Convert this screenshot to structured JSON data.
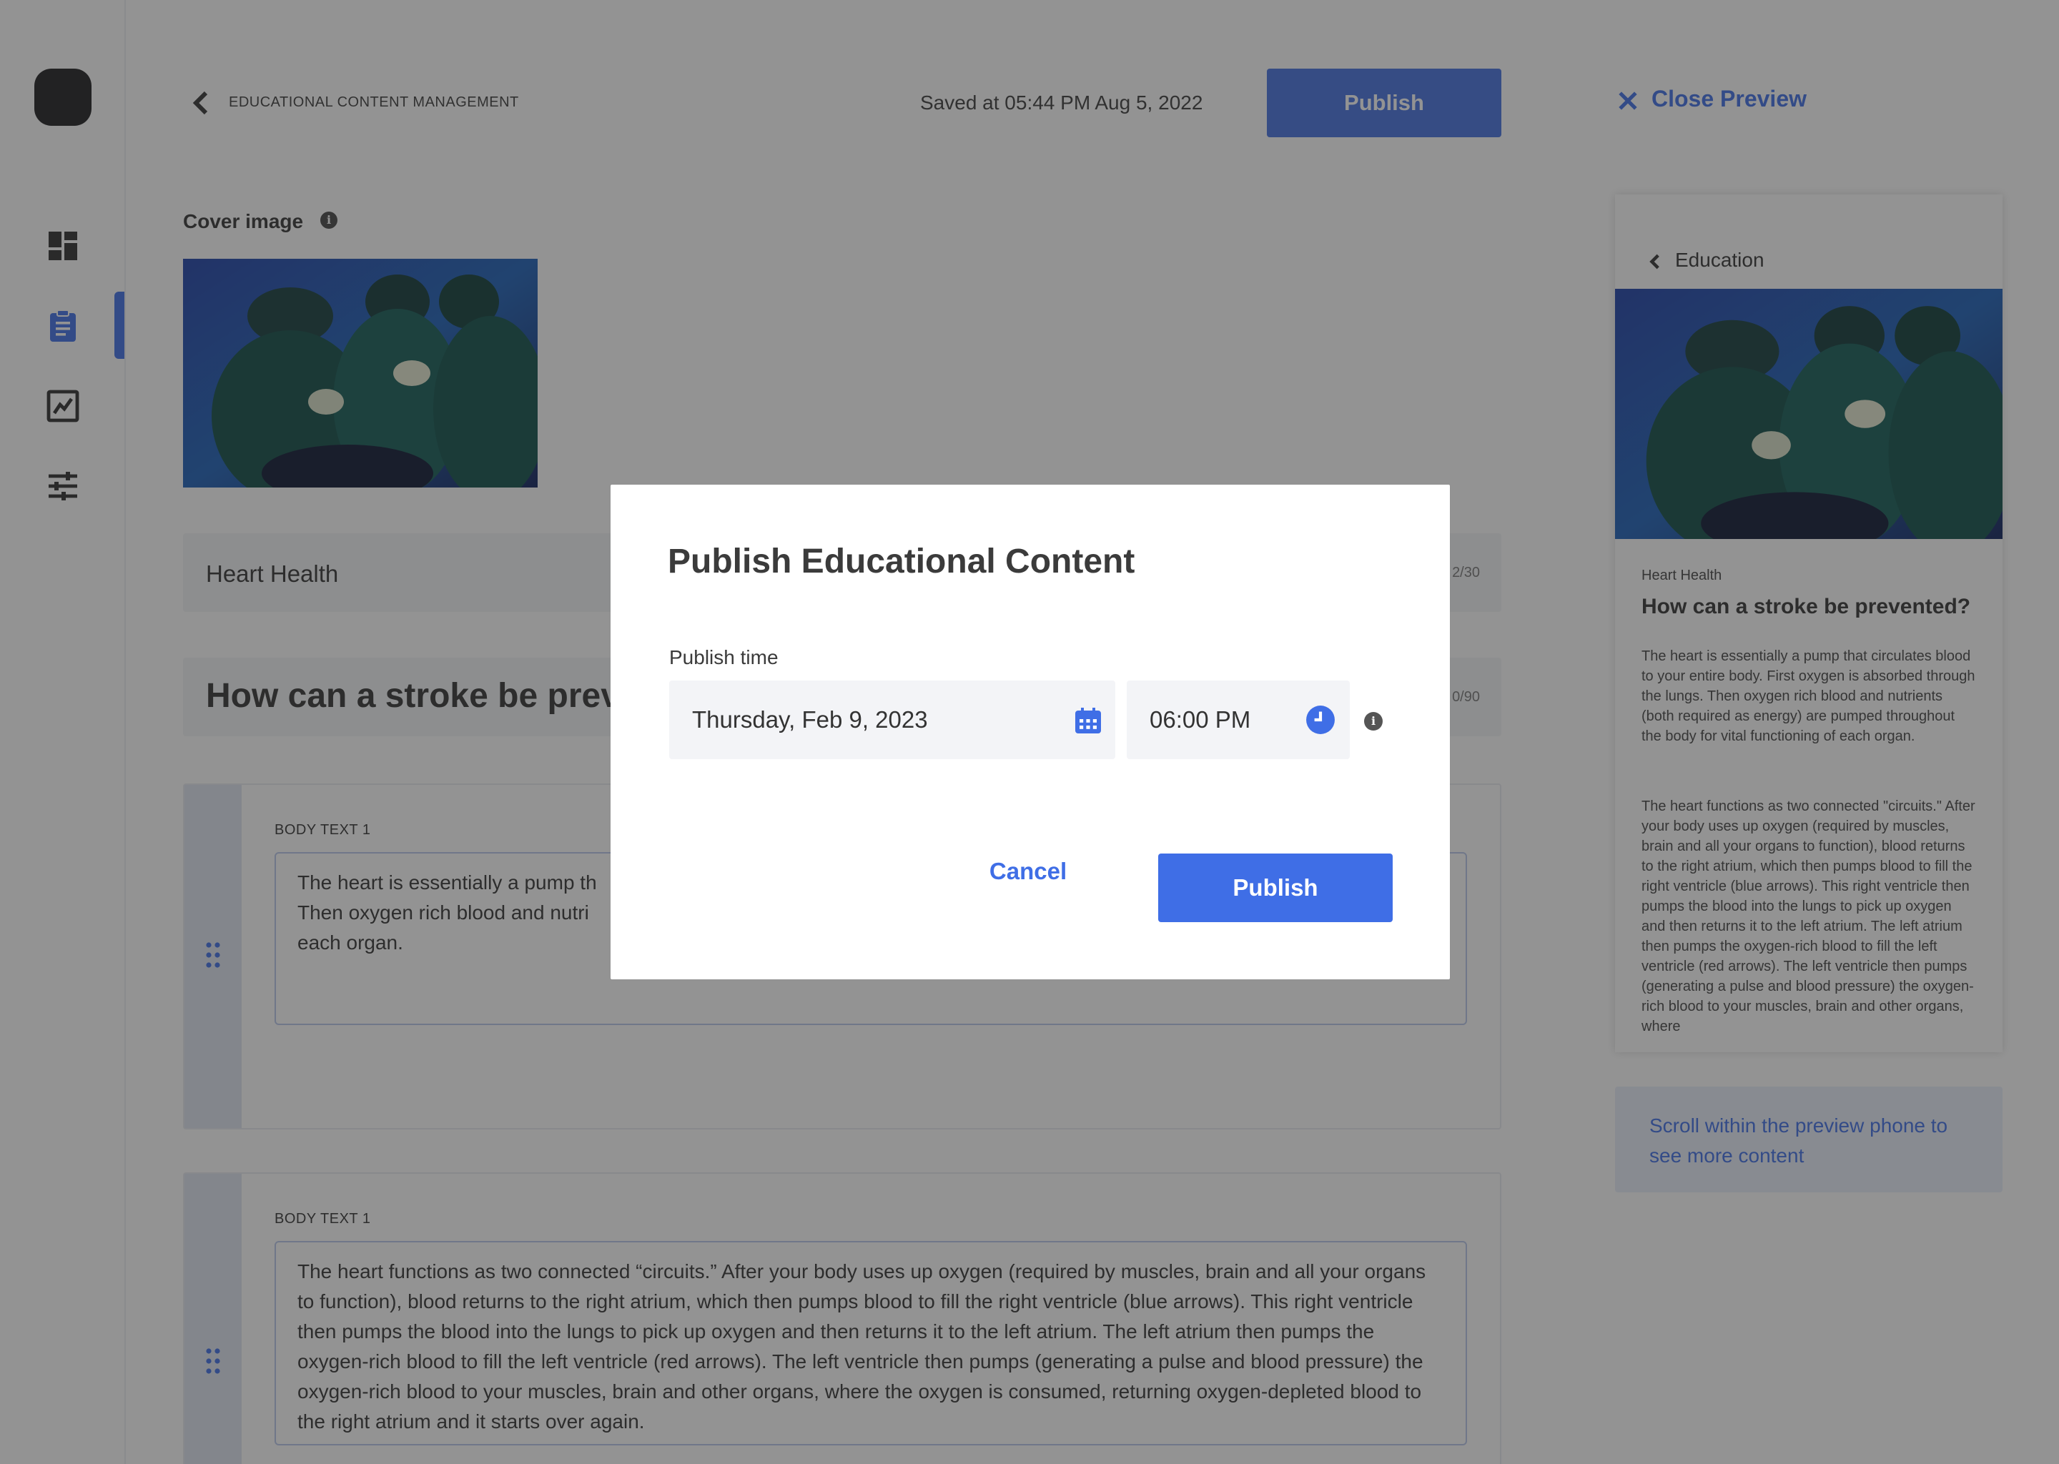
{
  "header": {
    "breadcrumb": "EDUCATIONAL CONTENT MANAGEMENT",
    "saved_text": "Saved at 05:44 PM Aug 5, 2022",
    "publish_label": "Publish"
  },
  "nav": {
    "items": [
      "dashboard-icon",
      "clipboard-icon",
      "chart-icon",
      "sliders-icon"
    ],
    "active_index": 1
  },
  "editor": {
    "cover_label": "Cover image",
    "category_value": "Heart Health",
    "category_count": "2/30",
    "title_value": "How can a stroke be prevented?",
    "title_visible": "How can a stroke be prev",
    "title_count": "0/90",
    "body_blocks": [
      {
        "label": "BODY TEXT 1",
        "text": "The heart is essentially a pump th\nThen oxygen rich blood and nutri\neach organ."
      },
      {
        "label": "BODY TEXT 1",
        "text": "The heart functions as two connected “circuits.” After your body uses up oxygen (required by muscles, brain and all your organs to function), blood returns to the right atrium, which then pumps blood to fill the right ventricle (blue arrows). This right ventricle then pumps the blood into the lungs to pick up oxygen and then returns it to the left atrium. The left atrium then pumps the oxygen-rich blood to fill the left ventricle (red arrows). The left ventricle then pumps (generating a pulse and blood pressure) the oxygen-rich blood to your muscles, brain and other organs, where the oxygen is consumed, returning oxygen-depleted blood to the right atrium and it starts over again."
      }
    ]
  },
  "preview": {
    "close_label": "Close Preview",
    "back_label": "Education",
    "category": "Heart Health",
    "title": "How can a stroke be prevented?",
    "paragraphs": [
      "The heart is essentially a pump that circulates blood to your entire body. First oxygen is absorbed through the lungs. Then oxygen rich blood and nutrients (both required as energy) are pumped throughout the body for vital functioning of each organ.",
      "The heart functions as two connected \"circuits.\" After your body uses up oxygen (required by muscles, brain and all your organs to function), blood returns to the right atrium, which then pumps blood to fill the right ventricle (blue arrows). This right ventricle then pumps the blood into the lungs to pick up oxygen and then returns it to the left atrium. The left atrium then pumps the oxygen-rich blood to fill the left ventricle (red arrows). The left ventricle then pumps (generating a pulse and blood pressure) the oxygen-rich blood to your muscles, brain and other organs, where"
    ],
    "scroll_hint": "Scroll within the preview phone to see more content"
  },
  "modal": {
    "title": "Publish Educational Content",
    "publish_time_label": "Publish time",
    "date_value": "Thursday, Feb 9, 2023",
    "time_value": "06:00 PM",
    "cancel_label": "Cancel",
    "publish_label": "Publish"
  },
  "colors": {
    "accent": "#3f6ee6",
    "overlay": "rgba(40,40,40,0.5)",
    "field_bg": "#f3f4f7"
  }
}
